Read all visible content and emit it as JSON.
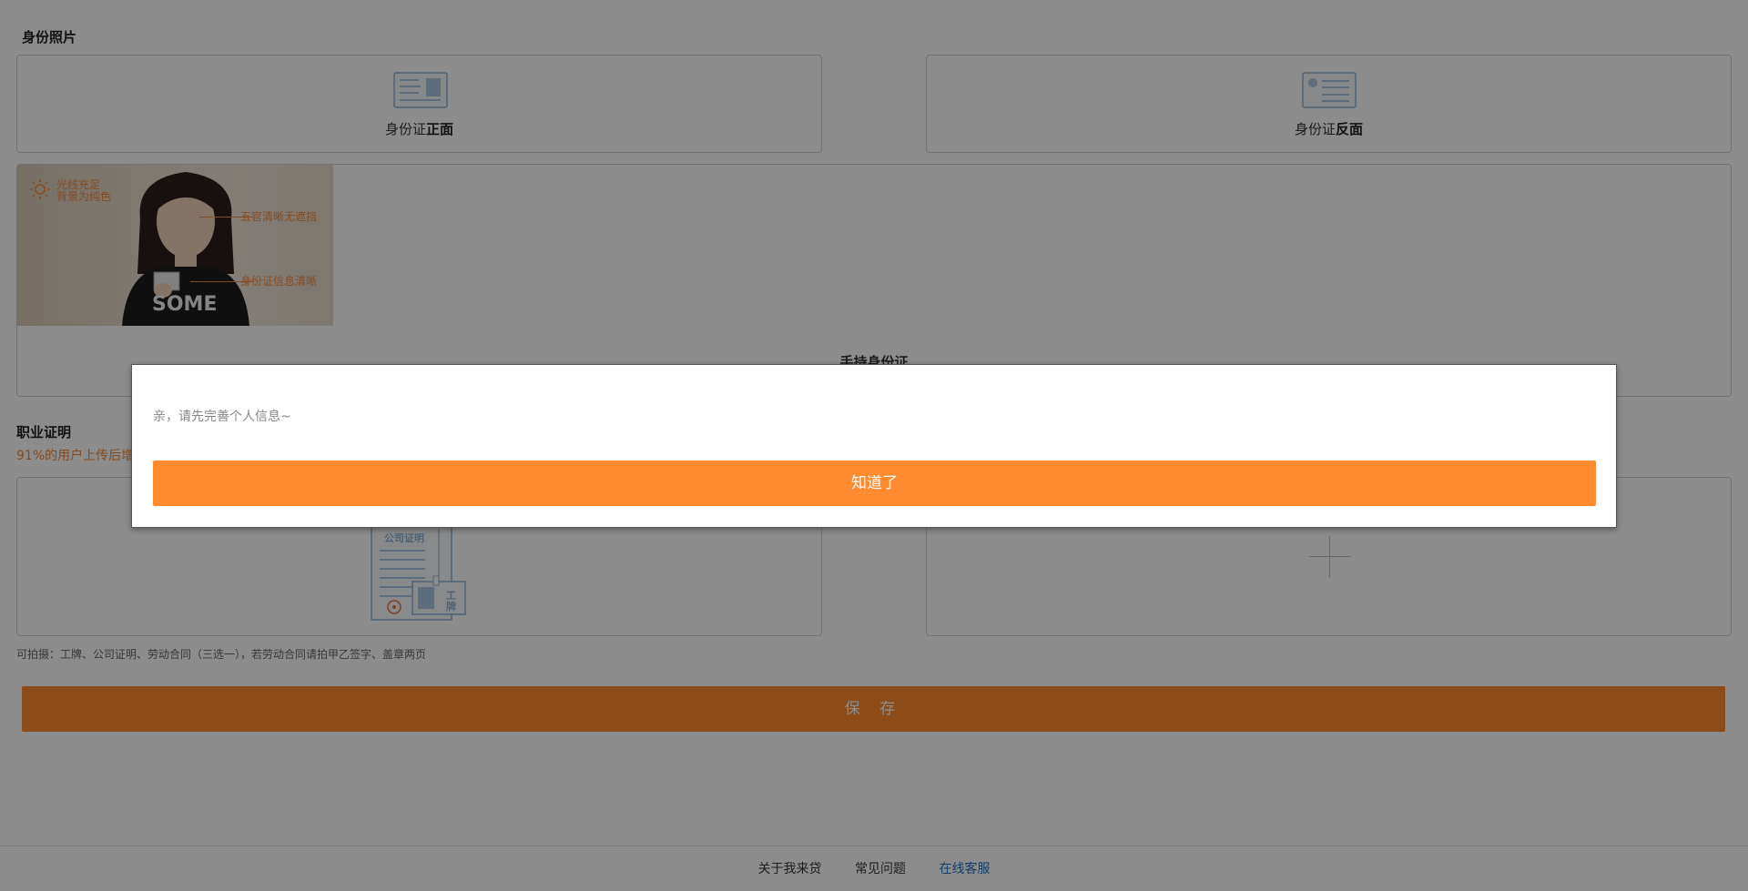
{
  "id_section": {
    "title": "身份照片",
    "front_label_prefix": "身份证",
    "front_label_bold": "正面",
    "back_label_prefix": "身份证",
    "back_label_bold": "反面",
    "handheld_label": "手持身份证",
    "sample_hints": {
      "light": "光线充足",
      "background": "背景为纯色",
      "face": "五官清晰无遮挡",
      "id_info": "身份证信息清晰",
      "shirt_text": "SOME"
    }
  },
  "job_section": {
    "title": "职业证明",
    "subtitle": "91%的用户上传后增",
    "company_cert_label": "公司证明",
    "badge_label": "工牌",
    "note": "可拍摄：工牌、公司证明、劳动合同（三选一），若劳动合同请拍甲乙签字、盖章两页"
  },
  "save_button": "保 存",
  "footer": {
    "links": [
      "关于我来贷",
      "常见问题",
      "在线客服"
    ]
  },
  "modal": {
    "message": "亲，请先完善个人信息~",
    "confirm_label": "知道了"
  },
  "colors": {
    "accent": "#ff8a30",
    "link": "#1e6fc0",
    "hint": "#f08a3c"
  },
  "icons": [
    "id-front-icon",
    "id-back-icon",
    "sun-icon",
    "plus-icon",
    "company-cert-icon"
  ]
}
